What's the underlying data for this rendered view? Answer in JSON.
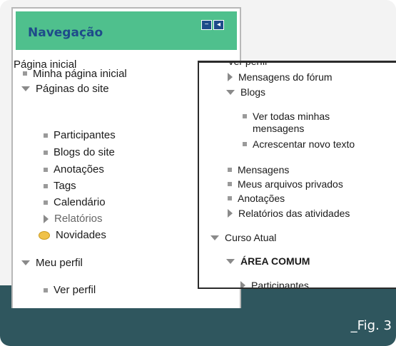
{
  "nav": {
    "title": "Navegação",
    "dock_icons": [
      "dock-minus-icon",
      "dock-arrow-icon"
    ],
    "home": "Página inicial",
    "items": [
      {
        "label": "Minha página inicial",
        "marker": "bullet"
      },
      {
        "label": "Páginas do site",
        "marker": "expanded"
      },
      {
        "label": "Participantes",
        "marker": "bullet"
      },
      {
        "label": "Blogs do site",
        "marker": "bullet"
      },
      {
        "label": "Anotações",
        "marker": "bullet"
      },
      {
        "label": "Tags",
        "marker": "bullet"
      },
      {
        "label": "Calendário",
        "marker": "bullet"
      },
      {
        "label": "Relatórios",
        "marker": "collapsed"
      },
      {
        "label": "Novidades",
        "marker": "speech"
      },
      {
        "label": "Meu perfil",
        "marker": "expanded"
      },
      {
        "label": "Ver perfil",
        "marker": "bullet"
      }
    ]
  },
  "popup": {
    "items": [
      {
        "label": "Ver perfil",
        "marker": "none"
      },
      {
        "label": "Mensagens do fórum",
        "marker": "collapsed"
      },
      {
        "label": "Blogs",
        "marker": "expanded"
      },
      {
        "label": "Ver todas minhas",
        "marker": "bullet"
      },
      {
        "label": "mensagens",
        "marker": "none"
      },
      {
        "label": "Acrescentar novo texto",
        "marker": "bullet"
      },
      {
        "label": "Mensagens",
        "marker": "bullet"
      },
      {
        "label": "Meus arquivos privados",
        "marker": "bullet"
      },
      {
        "label": "Anotações",
        "marker": "bullet"
      },
      {
        "label": "Relatórios das atividades",
        "marker": "collapsed"
      },
      {
        "label": "Curso Atual",
        "marker": "expanded"
      },
      {
        "label": "ÁREA COMUM",
        "marker": "expanded"
      },
      {
        "label": "Participantes",
        "marker": "collapsed"
      }
    ]
  },
  "figure": {
    "label": "_Fig. 3"
  },
  "colors": {
    "header_green": "#4fc08d",
    "title_blue": "#1e4b8a",
    "footer_teal": "#2f565e"
  }
}
